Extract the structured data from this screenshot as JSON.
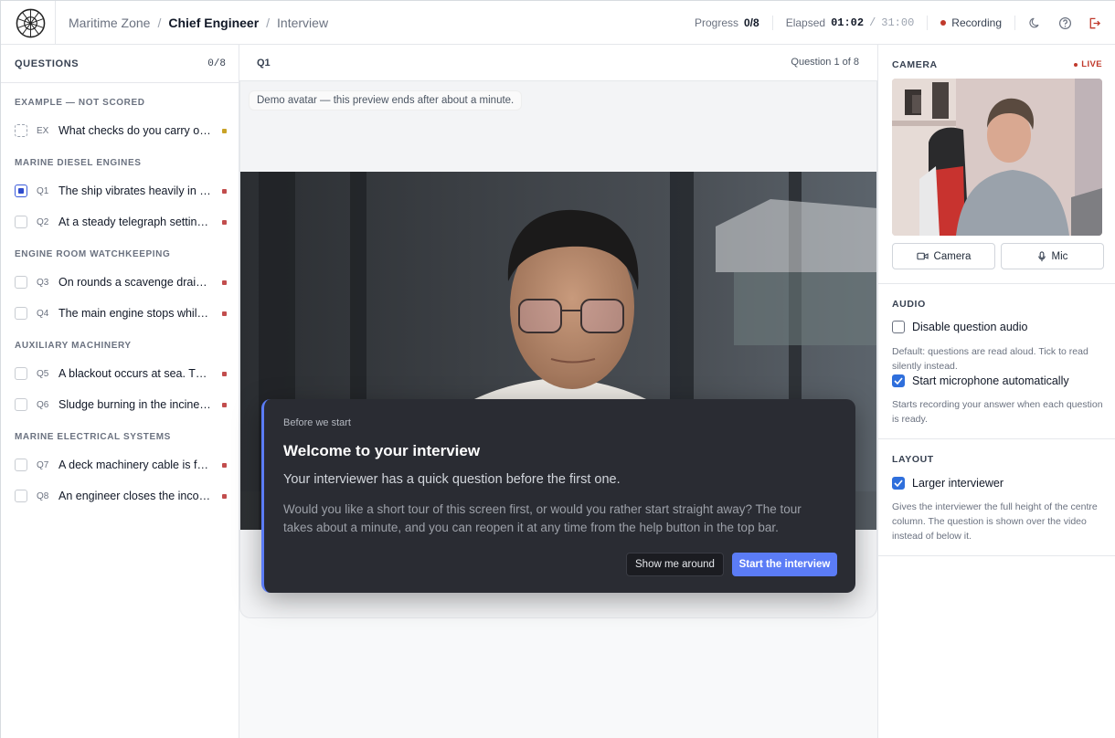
{
  "header": {
    "breadcrumb": [
      "Maritime Zone",
      "Chief Engineer",
      "Interview"
    ],
    "progress_label": "Progress",
    "progress_value": "0/8",
    "elapsed_label": "Elapsed",
    "elapsed_current": "01:02",
    "elapsed_sep": "/",
    "elapsed_total": "31:00",
    "recording_label": "Recording",
    "icons": [
      "moon-icon",
      "help-circle-icon",
      "logout-icon"
    ]
  },
  "sidebar": {
    "title": "QUESTIONS",
    "count": "0/8",
    "sections": [
      {
        "label": "EXAMPLE — NOT SCORED",
        "items": [
          {
            "code": "EX",
            "text": "What checks do you carry out before starting a main engine?",
            "state": "example"
          }
        ]
      },
      {
        "label": "MARINE DIESEL ENGINES",
        "items": [
          {
            "code": "Q1",
            "text": "The ship vibrates heavily in one speed range",
            "state": "current"
          },
          {
            "code": "Q2",
            "text": "At a steady telegraph setting the speed drops",
            "state": "todo"
          }
        ]
      },
      {
        "label": "ENGINE ROOM WATCHKEEPING",
        "items": [
          {
            "code": "Q3",
            "text": "On rounds a scavenge drain shows oil",
            "state": "todo"
          },
          {
            "code": "Q4",
            "text": "The main engine stops while manoeuvring",
            "state": "todo"
          }
        ]
      },
      {
        "label": "AUXILIARY MACHINERY",
        "items": [
          {
            "code": "Q5",
            "text": "A blackout occurs at sea. The generator trips",
            "state": "todo"
          },
          {
            "code": "Q6",
            "text": "Sludge burning in the incinerator fails",
            "state": "todo"
          }
        ]
      },
      {
        "label": "MARINE ELECTRICAL SYSTEMS",
        "items": [
          {
            "code": "Q7",
            "text": "A deck machinery cable is found damaged",
            "state": "todo"
          },
          {
            "code": "Q8",
            "text": "An engineer closes the incoming breaker",
            "state": "todo"
          }
        ]
      }
    ]
  },
  "center": {
    "question_code": "Q1",
    "question_progress": "Question 1 of 8",
    "demo_notice": "Demo avatar — this preview ends after about a minute."
  },
  "dialog": {
    "kicker": "Before we start",
    "title": "Welcome to your interview",
    "subtitle": "Your interviewer has a quick question before the first one.",
    "body": "Would you like a short tour of this screen first, or would you rather start straight away? The tour takes about a minute, and you can reopen it at any time from the help button in the top bar.",
    "secondary_label": "Show me around",
    "primary_label": "Start the interview"
  },
  "right": {
    "camera_title": "CAMERA",
    "live_label": "LIVE",
    "camera_button": "Camera",
    "mic_button": "Mic",
    "audio_title": "AUDIO",
    "disable_audio_label": "Disable question audio",
    "disable_audio_checked": false,
    "disable_audio_help": "Default: questions are read aloud. Tick to read silently instead.",
    "auto_mic_label": "Start microphone automatically",
    "auto_mic_checked": true,
    "auto_mic_help": "Starts recording your answer when each question is ready.",
    "layout_title": "LAYOUT",
    "larger_label": "Larger interviewer",
    "larger_checked": true,
    "larger_help": "Gives the interviewer the full height of the centre column. The question is shown over the video instead of below it."
  },
  "colors": {
    "accent": "#5b7cf6",
    "recording": "#c0392b",
    "status_todo": "#c24d4d",
    "status_example": "#c9a227"
  }
}
